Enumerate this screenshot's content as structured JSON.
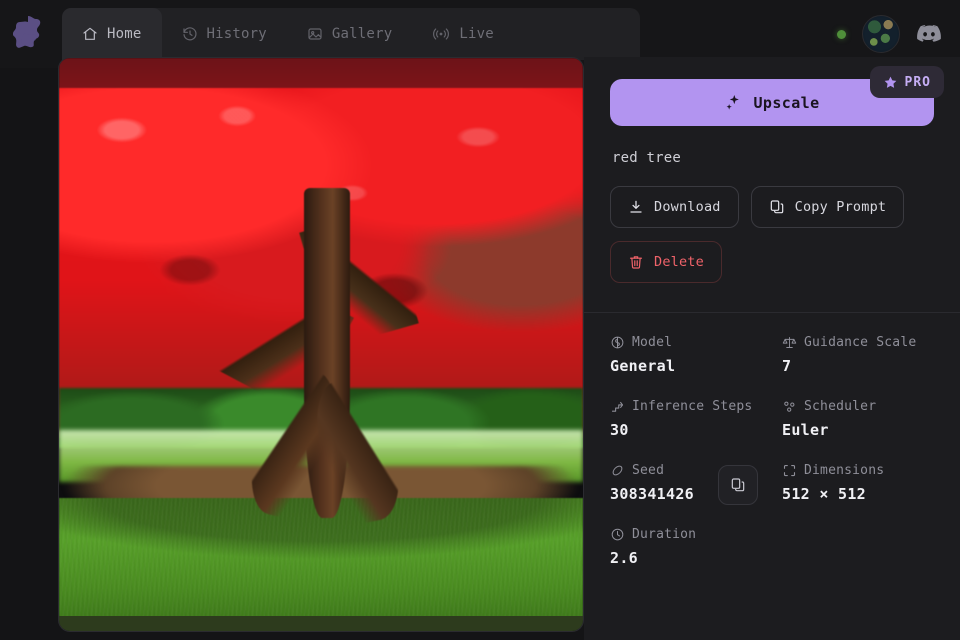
{
  "app": {
    "logo_icon": "puzzle-blob-logo",
    "accent_color": "#b294f0",
    "danger_color": "#f0636a",
    "panel_color": "#1c1c1f",
    "background_color": "#141416"
  },
  "nav": {
    "tabs": [
      {
        "label": "Home",
        "icon": "home-icon",
        "active": true
      },
      {
        "label": "History",
        "icon": "history-icon",
        "active": false
      },
      {
        "label": "Gallery",
        "icon": "gallery-icon",
        "active": false
      },
      {
        "label": "Live",
        "icon": "live-icon",
        "active": false
      }
    ],
    "status_dot": {
      "icon": "status-dot",
      "color": "#4f8f3a"
    },
    "avatar": {
      "icon": "avatar"
    },
    "discord": {
      "icon": "discord-icon"
    }
  },
  "image": {
    "alt": "red tree",
    "subject": "red maple tree on green lawn"
  },
  "actions": {
    "upscale_label": "Upscale",
    "upscale_icon": "sparkles-icon",
    "pro_label": "PRO",
    "pro_icon": "star-icon",
    "download_label": "Download",
    "download_icon": "download-icon",
    "copy_prompt_label": "Copy Prompt",
    "copy_prompt_icon": "copy-icon",
    "delete_label": "Delete",
    "delete_icon": "trash-icon"
  },
  "prompt": {
    "text": "red tree"
  },
  "metadata": [
    {
      "label": "Model",
      "value": "General",
      "icon": "brain-icon"
    },
    {
      "label": "Guidance Scale",
      "value": "7",
      "icon": "scales-icon"
    },
    {
      "label": "Inference Steps",
      "value": "30",
      "icon": "steps-icon"
    },
    {
      "label": "Scheduler",
      "value": "Euler",
      "icon": "scheduler-icon"
    },
    {
      "label": "Seed",
      "value": "308341426",
      "icon": "seed-icon"
    },
    {
      "label": "Dimensions",
      "value": "512 × 512",
      "icon": "dimensions-icon"
    },
    {
      "label": "Duration",
      "value": "2.6",
      "icon": "clock-icon"
    }
  ],
  "seed_copy": {
    "icon": "copy-icon"
  }
}
